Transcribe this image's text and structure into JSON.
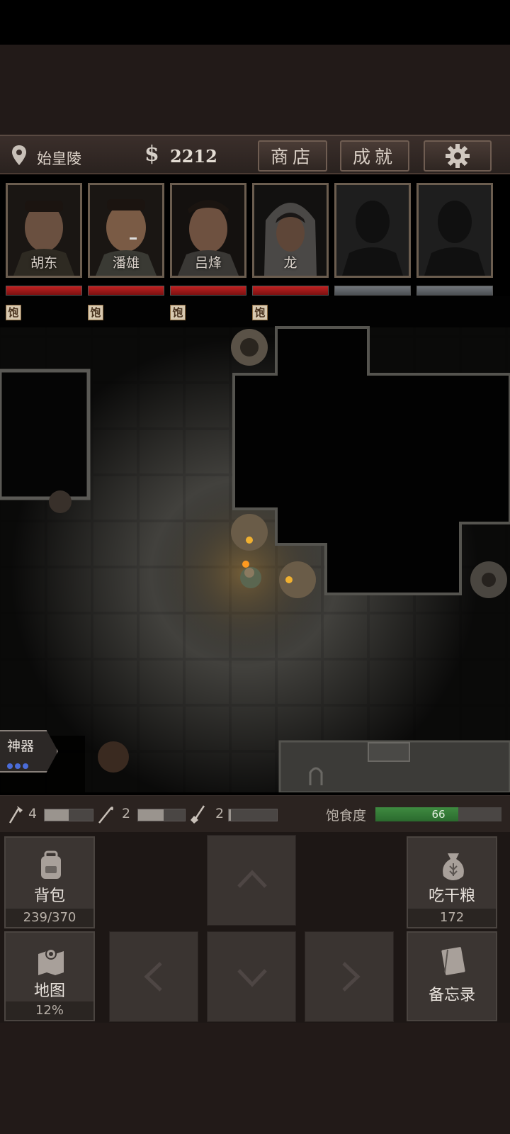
{
  "header": {
    "location": "始皇陵",
    "currency_symbol": "$",
    "money": "2212",
    "shop_label": "商店",
    "achievements_label": "成就"
  },
  "party": [
    {
      "name": "胡东",
      "hp_fraction": 1.0,
      "status": "饱"
    },
    {
      "name": "潘雄",
      "hp_fraction": 1.0,
      "status": "饱"
    },
    {
      "name": "吕烽",
      "hp_fraction": 1.0,
      "status": "饱"
    },
    {
      "name": "龙",
      "hp_fraction": 1.0,
      "status": "饱"
    },
    {
      "name": "",
      "hp_fraction": 0.0,
      "status": ""
    },
    {
      "name": "",
      "hp_fraction": 0.0,
      "status": ""
    }
  ],
  "artifact": {
    "label": "神器",
    "charges": 3
  },
  "tools": [
    {
      "icon": "axe-icon",
      "count": "4",
      "level": 0.5
    },
    {
      "icon": "hook-icon",
      "count": "2",
      "level": 0.55
    },
    {
      "icon": "shovel-icon",
      "count": "2",
      "level": 0.05
    }
  ],
  "hunger": {
    "label": "饱食度",
    "value": "66",
    "fraction": 0.66
  },
  "controls": {
    "backpack_label": "背包",
    "backpack_capacity": "239/370",
    "eat_label": "吃干粮",
    "eat_count": "172",
    "map_label": "地图",
    "map_progress": "12%",
    "notes_label": "备忘录"
  },
  "colors": {
    "hp": "#c02020",
    "hunger": "#3e8a40",
    "background": "#221a18"
  }
}
